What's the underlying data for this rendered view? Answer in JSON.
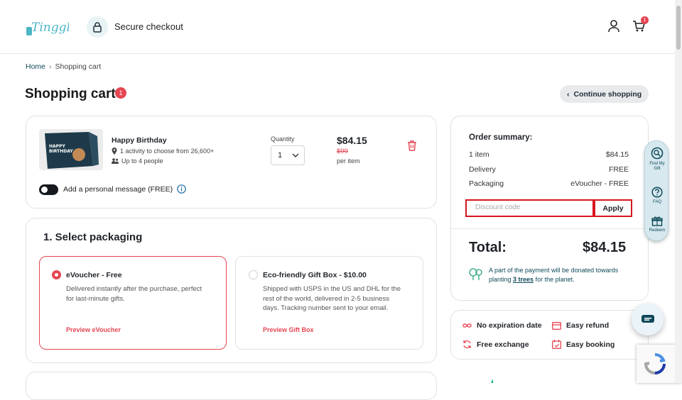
{
  "header": {
    "brand": "Tinggly",
    "secure_label": "Secure checkout",
    "cart_count": "1"
  },
  "breadcrumb": {
    "home": "Home",
    "current": "Shopping cart"
  },
  "page": {
    "title": "Shopping cart",
    "count": "1",
    "continue_label": "Continue shopping"
  },
  "item": {
    "name": "Happy Birthday",
    "image_text": "HAPPY BIRTHDAY",
    "activities": "1 activity to choose from 26,600+",
    "people": "Up to 4 people",
    "quantity_label": "Quantity",
    "quantity": "1",
    "price": "$84.15",
    "old_price": "$99",
    "per_item": "per item",
    "message_label": "Add a personal message (FREE)"
  },
  "packaging": {
    "title": "1. Select packaging",
    "options": [
      {
        "title": "eVoucher - Free",
        "desc_lines": [
          "Delivered instantly after the purchase, perfect",
          "for last-minute gifts."
        ],
        "link": "Preview eVoucher",
        "selected": true
      },
      {
        "title": "Eco-friendly Gift Box - $10.00",
        "desc_lines": [
          "Shipped with USPS in the US and DHL for the",
          "rest of the world, delivered in 2-5 business",
          "days. Tracking number sent to your email."
        ],
        "link": "Preview Gift Box",
        "selected": false
      }
    ]
  },
  "summary": {
    "title": "Order summary:",
    "rows": [
      {
        "label": "1 item",
        "value": "$84.15"
      },
      {
        "label": "Delivery",
        "value": "FREE"
      },
      {
        "label": "Packaging",
        "value": "eVoucher - FREE"
      }
    ],
    "discount_placeholder": "Discount code",
    "apply_label": "Apply",
    "total_label": "Total:",
    "total_value": "$84.15",
    "donation_line1": "A part of the payment will be donated towards",
    "donation_pre": "planting ",
    "donation_link": "3 trees",
    "donation_post": " for the planet."
  },
  "features": [
    "No expiration date",
    "Easy refund",
    "Free exchange",
    "Easy booking"
  ],
  "sidebar": [
    {
      "label1": "Find My",
      "label2": "Gift",
      "icon": "find-gift-icon"
    },
    {
      "label1": "FAQ",
      "label2": "",
      "icon": "faq-icon"
    },
    {
      "label1": "Redeem",
      "label2": "",
      "icon": "redeem-icon"
    }
  ],
  "colors": {
    "accent_red": "#e64553",
    "brand_teal": "#4db6c4",
    "dark_teal": "#0f4a5a"
  }
}
